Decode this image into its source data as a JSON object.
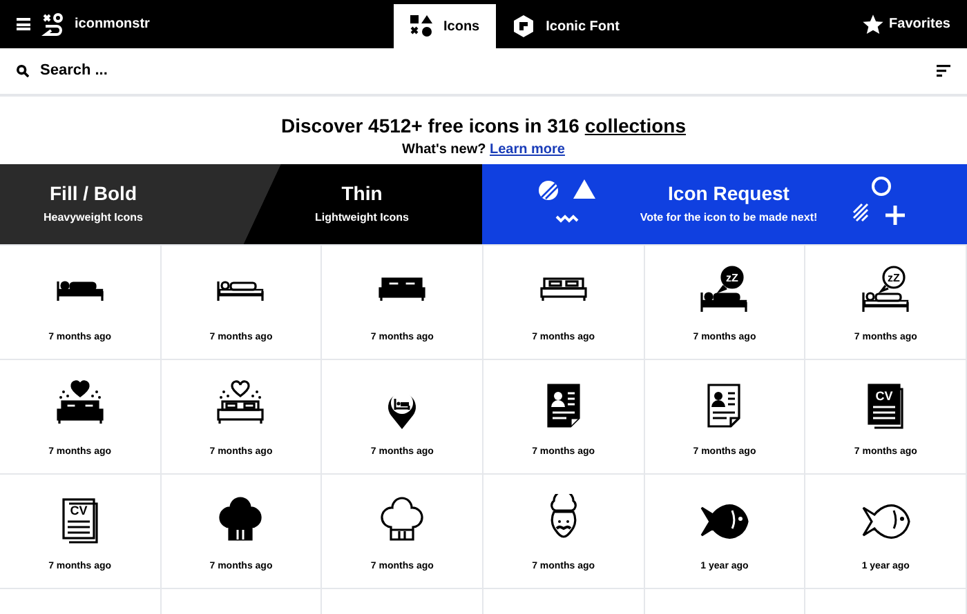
{
  "nav": {
    "logo": "iconmonstr",
    "tabs": [
      {
        "label": "Icons",
        "selected": true,
        "kind": "shapes"
      },
      {
        "label": "Iconic Font",
        "selected": false,
        "kind": "font"
      }
    ],
    "favorites": "Favorites"
  },
  "search": {
    "placeholder": "Search ..."
  },
  "headline": {
    "text": "Discover 4512+ free icons in 316 ",
    "link": "collections"
  },
  "whats_new": {
    "text": "What's new?",
    "link": "Learn more"
  },
  "banners": [
    {
      "kind": "fill",
      "title": "Fill / Bold",
      "subtitle": "Heavyweight Icons"
    },
    {
      "kind": "thin",
      "title": "Thin",
      "subtitle": "Lightweight Icons"
    },
    {
      "kind": "request",
      "title": "Icon Request",
      "subtitle": "Vote for the icon to be made next!"
    }
  ],
  "icons": [
    {
      "kind": "bed-person",
      "solid": true,
      "time": "7 months ago"
    },
    {
      "kind": "bed-person",
      "solid": false,
      "time": "7 months ago"
    },
    {
      "kind": "double-bed",
      "solid": true,
      "time": "7 months ago"
    },
    {
      "kind": "double-bed",
      "solid": false,
      "time": "7 months ago"
    },
    {
      "kind": "sleep",
      "solid": true,
      "text": "zZ",
      "time": "7 months ago"
    },
    {
      "kind": "sleep",
      "solid": false,
      "text": "zZ",
      "time": "7 months ago"
    },
    {
      "kind": "love-bed",
      "solid": true,
      "time": "7 months ago"
    },
    {
      "kind": "love-bed",
      "solid": false,
      "time": "7 months ago"
    },
    {
      "kind": "bed-pin",
      "time": "7 months ago"
    },
    {
      "kind": "resume",
      "solid": true,
      "time": "7 months ago"
    },
    {
      "kind": "resume",
      "solid": false,
      "time": "7 months ago"
    },
    {
      "kind": "cv",
      "solid": true,
      "text": "CV",
      "time": "7 months ago"
    },
    {
      "kind": "cv",
      "solid": false,
      "text": "CV",
      "time": "7 months ago"
    },
    {
      "kind": "chef-hat",
      "solid": true,
      "time": "7 months ago"
    },
    {
      "kind": "chef-hat",
      "solid": false,
      "time": "7 months ago"
    },
    {
      "kind": "chef",
      "time": "7 months ago"
    },
    {
      "kind": "fish",
      "solid": true,
      "time": "1 year ago"
    },
    {
      "kind": "fish",
      "solid": false,
      "time": "1 year ago"
    }
  ]
}
